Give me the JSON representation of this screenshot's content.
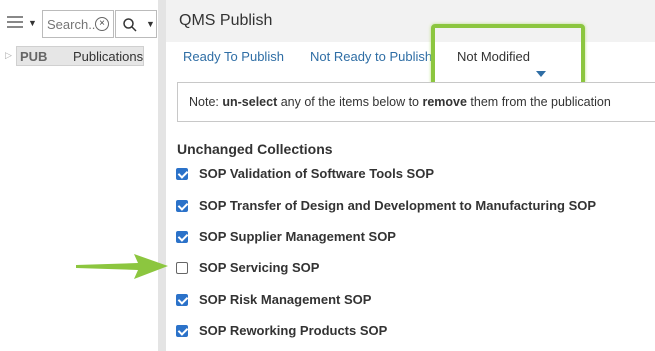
{
  "search": {
    "placeholder": "Search..."
  },
  "tree": {
    "code": "PUB",
    "label": "Publications"
  },
  "header": {
    "title": "QMS Publish"
  },
  "tabs": [
    {
      "label": "Ready To Publish"
    },
    {
      "label": "Not Ready to Publish"
    },
    {
      "label": "Not Modified"
    }
  ],
  "note": {
    "prefix": "Note: ",
    "bold1": "un-select",
    "middle": " any of the items below to ",
    "bold2": "remove",
    "suffix": " them from the publication"
  },
  "section": {
    "title": "Unchanged Collections"
  },
  "items": [
    {
      "label": "SOP Validation of Software Tools SOP",
      "checked": true
    },
    {
      "label": "SOP Transfer of Design and Development to Manufacturing SOP",
      "checked": true
    },
    {
      "label": "SOP Supplier Management SOP",
      "checked": true
    },
    {
      "label": "SOP Servicing SOP",
      "checked": false
    },
    {
      "label": "SOP Risk Management SOP",
      "checked": true
    },
    {
      "label": "SOP Reworking Products SOP",
      "checked": true
    }
  ],
  "colors": {
    "accent": "#2f6ea5",
    "checkbox": "#2b72c9",
    "highlight": "#8cc63f"
  },
  "icons": [
    "menu-icon",
    "clear-icon",
    "search-icon",
    "chevron-down-icon",
    "tree-expand-icon",
    "pointer-arrow"
  ]
}
